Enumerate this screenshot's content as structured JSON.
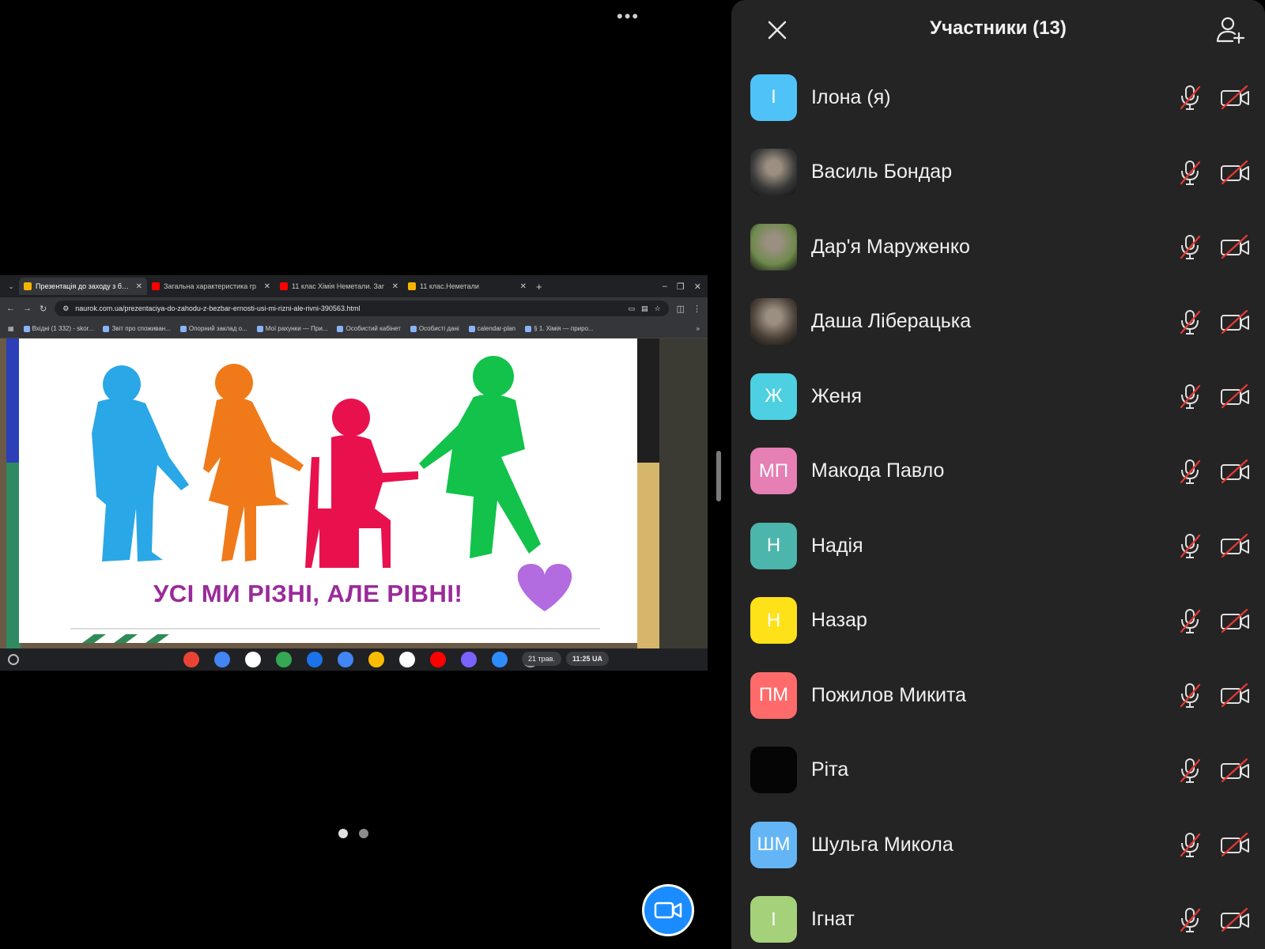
{
  "meeting": {
    "more_label": "•••",
    "page_dots": 2,
    "active_page": 0
  },
  "browser": {
    "tabs": [
      {
        "title": "Презентація до заходу з безб",
        "favicon_color": "#f4b400",
        "active": true
      },
      {
        "title": "Загальна характеристика гр",
        "favicon_color": "#ff0000",
        "active": false
      },
      {
        "title": "11 клас Хімія Неметали. Заг",
        "favicon_color": "#ff0000",
        "active": false
      },
      {
        "title": "11 клас.Неметали",
        "favicon_color": "#f4b400",
        "active": false
      }
    ],
    "close_tab": "✕",
    "new_tab": "+",
    "url": "naurok.com.ua/prezentaciya-do-zahodu-z-bezbar-ernosti-usi-mi-rizni-ale-rivni-390563.html",
    "bookmarks": [
      "Вхідні (1 332) - skor...",
      "Звіт про споживан...",
      "Опорний заклад о...",
      "Мої рахунки — При...",
      "Особистий кабінет",
      "Особисті дані",
      "calendar-plan",
      "§ 1. Хімія — приро..."
    ],
    "bookmarks_more": "»"
  },
  "slide": {
    "caption": "УСІ МИ РІЗНІ, АЛЕ РІВНІ!",
    "figure_colors": [
      "#2aa7e6",
      "#f07a1a",
      "#e8114e",
      "#12c24a"
    ],
    "heart_color": "#b36be0"
  },
  "shelf": {
    "app_colors": [
      "#ea4335",
      "#4285f4",
      "#ffffff",
      "#34a853",
      "#1a73e8",
      "#4285f4",
      "#fbbc04",
      "#ffffff",
      "#ff0000",
      "#7b61ff",
      "#2d8cff",
      "#9aa0a6"
    ],
    "date": "21 трав.",
    "time": "11:25",
    "locale": "UA"
  },
  "panel": {
    "title": "Участники (13)",
    "participants": [
      {
        "name": "Ілона (я)",
        "initials": "І",
        "color": "#4fc3f7",
        "photo": false
      },
      {
        "name": "Василь Бондар",
        "initials": "",
        "color": "#3a3a3a",
        "photo": true
      },
      {
        "name": "Дар'я Маруженко",
        "initials": "",
        "color": "#6f8a4c",
        "photo": true
      },
      {
        "name": "Даша Ліберацька",
        "initials": "",
        "color": "#4a4038",
        "photo": true
      },
      {
        "name": "Женя",
        "initials": "Ж",
        "color": "#4dd0e1",
        "photo": false
      },
      {
        "name": "Макода Павло",
        "initials": "МП",
        "color": "#e57fb4",
        "photo": false
      },
      {
        "name": "Надія",
        "initials": "Н",
        "color": "#4db6ac",
        "photo": false
      },
      {
        "name": "Назар",
        "initials": "Н",
        "color": "#ffe11a",
        "photo": false
      },
      {
        "name": "Пожилов Микита",
        "initials": "ПМ",
        "color": "#ff6b6b",
        "photo": false
      },
      {
        "name": "Ріта",
        "initials": "",
        "color": "#050505",
        "photo": false
      },
      {
        "name": "Шульга Микола",
        "initials": "ШМ",
        "color": "#64b5f6",
        "photo": false
      },
      {
        "name": "Ігнат",
        "initials": "І",
        "color": "#a5d17a",
        "photo": false
      }
    ]
  },
  "colors": {
    "panel_bg": "#242424",
    "muted_red": "#e53935",
    "video_button": "#1a8cff"
  }
}
